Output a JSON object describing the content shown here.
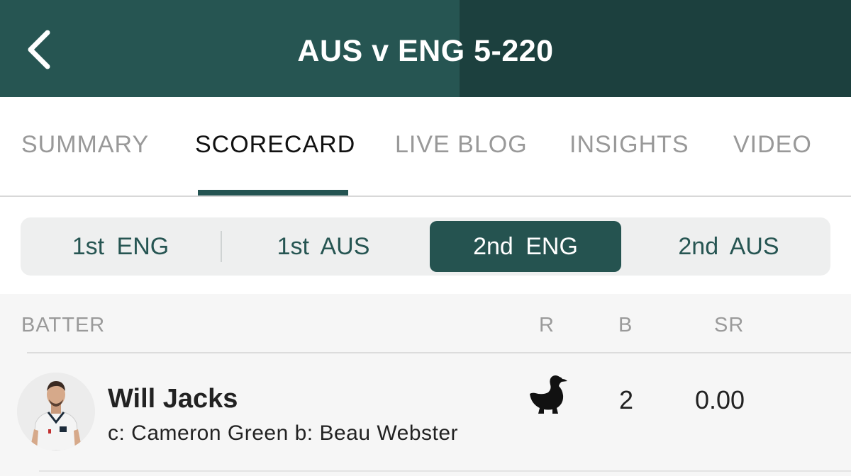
{
  "header": {
    "title": "AUS v ENG 5-220",
    "back_icon": "chevron-left-icon",
    "colors": {
      "primary": "#265552",
      "dark": "#1c403e"
    }
  },
  "tabs": [
    {
      "label": "SUMMARY",
      "active": false
    },
    {
      "label": "SCORECARD",
      "active": true
    },
    {
      "label": "LIVE BLOG",
      "active": false
    },
    {
      "label": "INSIGHTS",
      "active": false
    },
    {
      "label": "VIDEO",
      "active": false
    }
  ],
  "innings": [
    {
      "label": "1st ENG",
      "active": false
    },
    {
      "label": "1st AUS",
      "active": false
    },
    {
      "label": "2nd ENG",
      "active": true
    },
    {
      "label": "2nd AUS",
      "active": false
    }
  ],
  "batting": {
    "columns": {
      "batter": "BATTER",
      "runs": "R",
      "balls": "B",
      "strike_rate": "SR"
    },
    "rows": [
      {
        "name": "Will Jacks",
        "dismissal": "c: Cameron Green b: Beau Webster",
        "runs_icon": "duck-icon",
        "balls": "2",
        "strike_rate": "0.00"
      }
    ]
  }
}
